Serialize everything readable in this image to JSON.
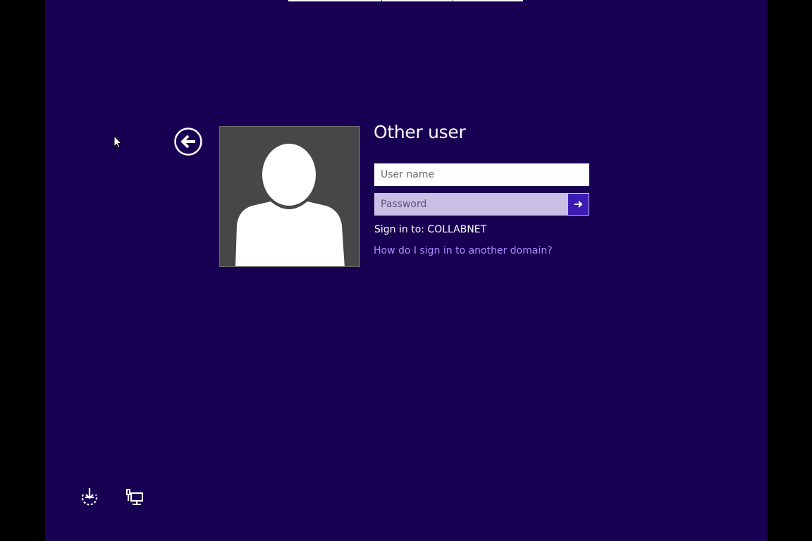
{
  "login": {
    "title": "Other user",
    "username_placeholder": "User name",
    "username_value": "",
    "password_placeholder": "Password",
    "password_value": "",
    "sign_in_to": "Sign in to: COLLABNET",
    "domain_help_link": "How do I sign in to another domain?"
  },
  "icons": {
    "back": "back-arrow-icon",
    "submit": "arrow-right-icon",
    "avatar": "user-silhouette-icon",
    "ease_of_access": "ease-of-access-icon",
    "network": "network-icon"
  },
  "colors": {
    "background": "#180052",
    "link": "#a98fff",
    "submit_button": "#3d1bb5",
    "avatar_bg": "#474747"
  }
}
